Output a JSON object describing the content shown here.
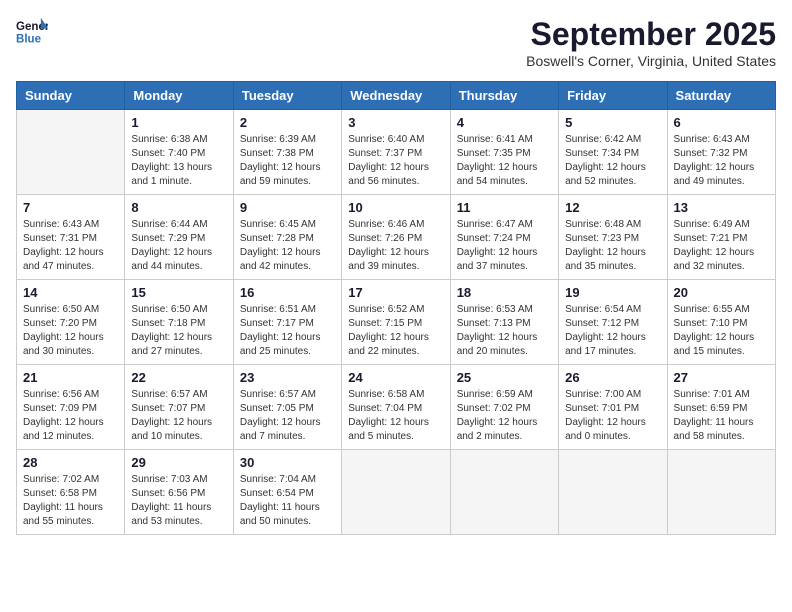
{
  "logo": {
    "line1": "General",
    "line2": "Blue"
  },
  "title": "September 2025",
  "location": "Boswell's Corner, Virginia, United States",
  "headers": [
    "Sunday",
    "Monday",
    "Tuesday",
    "Wednesday",
    "Thursday",
    "Friday",
    "Saturday"
  ],
  "weeks": [
    [
      {
        "day": "",
        "info": ""
      },
      {
        "day": "1",
        "info": "Sunrise: 6:38 AM\nSunset: 7:40 PM\nDaylight: 13 hours\nand 1 minute."
      },
      {
        "day": "2",
        "info": "Sunrise: 6:39 AM\nSunset: 7:38 PM\nDaylight: 12 hours\nand 59 minutes."
      },
      {
        "day": "3",
        "info": "Sunrise: 6:40 AM\nSunset: 7:37 PM\nDaylight: 12 hours\nand 56 minutes."
      },
      {
        "day": "4",
        "info": "Sunrise: 6:41 AM\nSunset: 7:35 PM\nDaylight: 12 hours\nand 54 minutes."
      },
      {
        "day": "5",
        "info": "Sunrise: 6:42 AM\nSunset: 7:34 PM\nDaylight: 12 hours\nand 52 minutes."
      },
      {
        "day": "6",
        "info": "Sunrise: 6:43 AM\nSunset: 7:32 PM\nDaylight: 12 hours\nand 49 minutes."
      }
    ],
    [
      {
        "day": "7",
        "info": "Sunrise: 6:43 AM\nSunset: 7:31 PM\nDaylight: 12 hours\nand 47 minutes."
      },
      {
        "day": "8",
        "info": "Sunrise: 6:44 AM\nSunset: 7:29 PM\nDaylight: 12 hours\nand 44 minutes."
      },
      {
        "day": "9",
        "info": "Sunrise: 6:45 AM\nSunset: 7:28 PM\nDaylight: 12 hours\nand 42 minutes."
      },
      {
        "day": "10",
        "info": "Sunrise: 6:46 AM\nSunset: 7:26 PM\nDaylight: 12 hours\nand 39 minutes."
      },
      {
        "day": "11",
        "info": "Sunrise: 6:47 AM\nSunset: 7:24 PM\nDaylight: 12 hours\nand 37 minutes."
      },
      {
        "day": "12",
        "info": "Sunrise: 6:48 AM\nSunset: 7:23 PM\nDaylight: 12 hours\nand 35 minutes."
      },
      {
        "day": "13",
        "info": "Sunrise: 6:49 AM\nSunset: 7:21 PM\nDaylight: 12 hours\nand 32 minutes."
      }
    ],
    [
      {
        "day": "14",
        "info": "Sunrise: 6:50 AM\nSunset: 7:20 PM\nDaylight: 12 hours\nand 30 minutes."
      },
      {
        "day": "15",
        "info": "Sunrise: 6:50 AM\nSunset: 7:18 PM\nDaylight: 12 hours\nand 27 minutes."
      },
      {
        "day": "16",
        "info": "Sunrise: 6:51 AM\nSunset: 7:17 PM\nDaylight: 12 hours\nand 25 minutes."
      },
      {
        "day": "17",
        "info": "Sunrise: 6:52 AM\nSunset: 7:15 PM\nDaylight: 12 hours\nand 22 minutes."
      },
      {
        "day": "18",
        "info": "Sunrise: 6:53 AM\nSunset: 7:13 PM\nDaylight: 12 hours\nand 20 minutes."
      },
      {
        "day": "19",
        "info": "Sunrise: 6:54 AM\nSunset: 7:12 PM\nDaylight: 12 hours\nand 17 minutes."
      },
      {
        "day": "20",
        "info": "Sunrise: 6:55 AM\nSunset: 7:10 PM\nDaylight: 12 hours\nand 15 minutes."
      }
    ],
    [
      {
        "day": "21",
        "info": "Sunrise: 6:56 AM\nSunset: 7:09 PM\nDaylight: 12 hours\nand 12 minutes."
      },
      {
        "day": "22",
        "info": "Sunrise: 6:57 AM\nSunset: 7:07 PM\nDaylight: 12 hours\nand 10 minutes."
      },
      {
        "day": "23",
        "info": "Sunrise: 6:57 AM\nSunset: 7:05 PM\nDaylight: 12 hours\nand 7 minutes."
      },
      {
        "day": "24",
        "info": "Sunrise: 6:58 AM\nSunset: 7:04 PM\nDaylight: 12 hours\nand 5 minutes."
      },
      {
        "day": "25",
        "info": "Sunrise: 6:59 AM\nSunset: 7:02 PM\nDaylight: 12 hours\nand 2 minutes."
      },
      {
        "day": "26",
        "info": "Sunrise: 7:00 AM\nSunset: 7:01 PM\nDaylight: 12 hours\nand 0 minutes."
      },
      {
        "day": "27",
        "info": "Sunrise: 7:01 AM\nSunset: 6:59 PM\nDaylight: 11 hours\nand 58 minutes."
      }
    ],
    [
      {
        "day": "28",
        "info": "Sunrise: 7:02 AM\nSunset: 6:58 PM\nDaylight: 11 hours\nand 55 minutes."
      },
      {
        "day": "29",
        "info": "Sunrise: 7:03 AM\nSunset: 6:56 PM\nDaylight: 11 hours\nand 53 minutes."
      },
      {
        "day": "30",
        "info": "Sunrise: 7:04 AM\nSunset: 6:54 PM\nDaylight: 11 hours\nand 50 minutes."
      },
      {
        "day": "",
        "info": ""
      },
      {
        "day": "",
        "info": ""
      },
      {
        "day": "",
        "info": ""
      },
      {
        "day": "",
        "info": ""
      }
    ]
  ]
}
